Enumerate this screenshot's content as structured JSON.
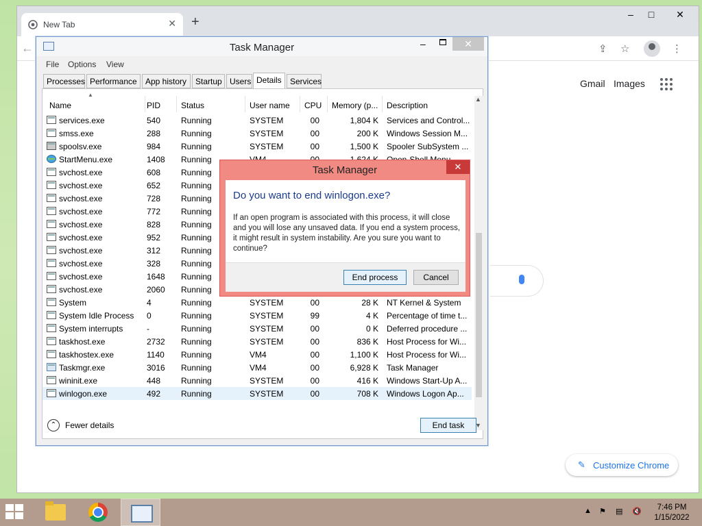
{
  "chrome": {
    "tab_title": "New Tab",
    "new_tab": "+",
    "minimize": "–",
    "maximize": "□",
    "close": "✕",
    "back": "←",
    "links": {
      "gmail": "Gmail",
      "images": "Images"
    },
    "customize_label": "Customize Chrome",
    "icons": [
      "chrome-favicon-icon",
      "share-icon",
      "star-icon",
      "profile-icon",
      "more-icon",
      "apps-grid-icon",
      "mic-icon",
      "pencil-icon"
    ]
  },
  "task_manager": {
    "title": "Task Manager",
    "close": "✕",
    "minimize": "–",
    "menu": [
      "File",
      "Options",
      "View"
    ],
    "tabs": [
      "Processes",
      "Performance",
      "App history",
      "Startup",
      "Users",
      "Details",
      "Services"
    ],
    "active_tab": "Details",
    "columns": [
      "Name",
      "PID",
      "Status",
      "User name",
      "CPU",
      "Memory (p...",
      "Description"
    ],
    "rows": [
      {
        "name": "services.exe",
        "pid": "540",
        "status": "Running",
        "user": "SYSTEM",
        "cpu": "00",
        "mem": "1,804 K",
        "desc": "Services and Control..."
      },
      {
        "name": "smss.exe",
        "pid": "288",
        "status": "Running",
        "user": "SYSTEM",
        "cpu": "00",
        "mem": "200 K",
        "desc": "Windows Session M..."
      },
      {
        "name": "spoolsv.exe",
        "pid": "984",
        "status": "Running",
        "user": "SYSTEM",
        "cpu": "00",
        "mem": "1,500 K",
        "desc": "Spooler SubSystem ..."
      },
      {
        "name": "StartMenu.exe",
        "pid": "1408",
        "status": "Running",
        "user": "VM4",
        "cpu": "00",
        "mem": "1,624 K",
        "desc": "Open-Shell Menu"
      },
      {
        "name": "svchost.exe",
        "pid": "608",
        "status": "Running",
        "user": "",
        "cpu": "",
        "mem": "",
        "desc": ""
      },
      {
        "name": "svchost.exe",
        "pid": "652",
        "status": "Running",
        "user": "",
        "cpu": "",
        "mem": "",
        "desc": ""
      },
      {
        "name": "svchost.exe",
        "pid": "728",
        "status": "Running",
        "user": "",
        "cpu": "",
        "mem": "",
        "desc": ""
      },
      {
        "name": "svchost.exe",
        "pid": "772",
        "status": "Running",
        "user": "",
        "cpu": "",
        "mem": "",
        "desc": ""
      },
      {
        "name": "svchost.exe",
        "pid": "828",
        "status": "Running",
        "user": "",
        "cpu": "",
        "mem": "",
        "desc": ""
      },
      {
        "name": "svchost.exe",
        "pid": "952",
        "status": "Running",
        "user": "",
        "cpu": "",
        "mem": "",
        "desc": ""
      },
      {
        "name": "svchost.exe",
        "pid": "312",
        "status": "Running",
        "user": "",
        "cpu": "",
        "mem": "",
        "desc": ""
      },
      {
        "name": "svchost.exe",
        "pid": "328",
        "status": "Running",
        "user": "",
        "cpu": "",
        "mem": "",
        "desc": ""
      },
      {
        "name": "svchost.exe",
        "pid": "1648",
        "status": "Running",
        "user": "",
        "cpu": "",
        "mem": "",
        "desc": ""
      },
      {
        "name": "svchost.exe",
        "pid": "2060",
        "status": "Running",
        "user": "",
        "cpu": "",
        "mem": "",
        "desc": ""
      },
      {
        "name": "System",
        "pid": "4",
        "status": "Running",
        "user": "SYSTEM",
        "cpu": "00",
        "mem": "28 K",
        "desc": "NT Kernel & System"
      },
      {
        "name": "System Idle Process",
        "pid": "0",
        "status": "Running",
        "user": "SYSTEM",
        "cpu": "99",
        "mem": "4 K",
        "desc": "Percentage of time t..."
      },
      {
        "name": "System interrupts",
        "pid": "-",
        "status": "Running",
        "user": "SYSTEM",
        "cpu": "00",
        "mem": "0 K",
        "desc": "Deferred procedure ..."
      },
      {
        "name": "taskhost.exe",
        "pid": "2732",
        "status": "Running",
        "user": "SYSTEM",
        "cpu": "00",
        "mem": "836 K",
        "desc": "Host Process for Wi..."
      },
      {
        "name": "taskhostex.exe",
        "pid": "1140",
        "status": "Running",
        "user": "VM4",
        "cpu": "00",
        "mem": "1,100 K",
        "desc": "Host Process for Wi..."
      },
      {
        "name": "Taskmgr.exe",
        "pid": "3016",
        "status": "Running",
        "user": "VM4",
        "cpu": "00",
        "mem": "6,928 K",
        "desc": "Task Manager"
      },
      {
        "name": "wininit.exe",
        "pid": "448",
        "status": "Running",
        "user": "SYSTEM",
        "cpu": "00",
        "mem": "416 K",
        "desc": "Windows Start-Up A..."
      },
      {
        "name": "winlogon.exe",
        "pid": "492",
        "status": "Running",
        "user": "SYSTEM",
        "cpu": "00",
        "mem": "708 K",
        "desc": "Windows Logon Ap..."
      }
    ],
    "selected_row": "winlogon.exe",
    "fewer_details": "Fewer details",
    "end_task": "End task"
  },
  "dialog": {
    "title": "Task Manager",
    "close": "✕",
    "heading": "Do you want to end winlogon.exe?",
    "message": "If an open program is associated with this process, it will close and you will lose any unsaved data. If you end a system process, it might result in system instability. Are you sure you want to continue?",
    "primary_button": "End process",
    "cancel_button": "Cancel"
  },
  "taskbar": {
    "time": "7:46 PM",
    "date": "1/15/2022",
    "tray_icons": [
      "show-hidden-icons-icon",
      "action-center-flag-icon",
      "network-icon",
      "volume-muted-icon"
    ],
    "tray_up": "▲"
  },
  "colors": {
    "desktop": "#c6e6ab",
    "taskbar": "#b39c8e",
    "dialog_frame": "#f08a82",
    "dialog_close": "#c83a3a",
    "selection": "#e5f1fb",
    "link_blue": "#1a73e8"
  }
}
